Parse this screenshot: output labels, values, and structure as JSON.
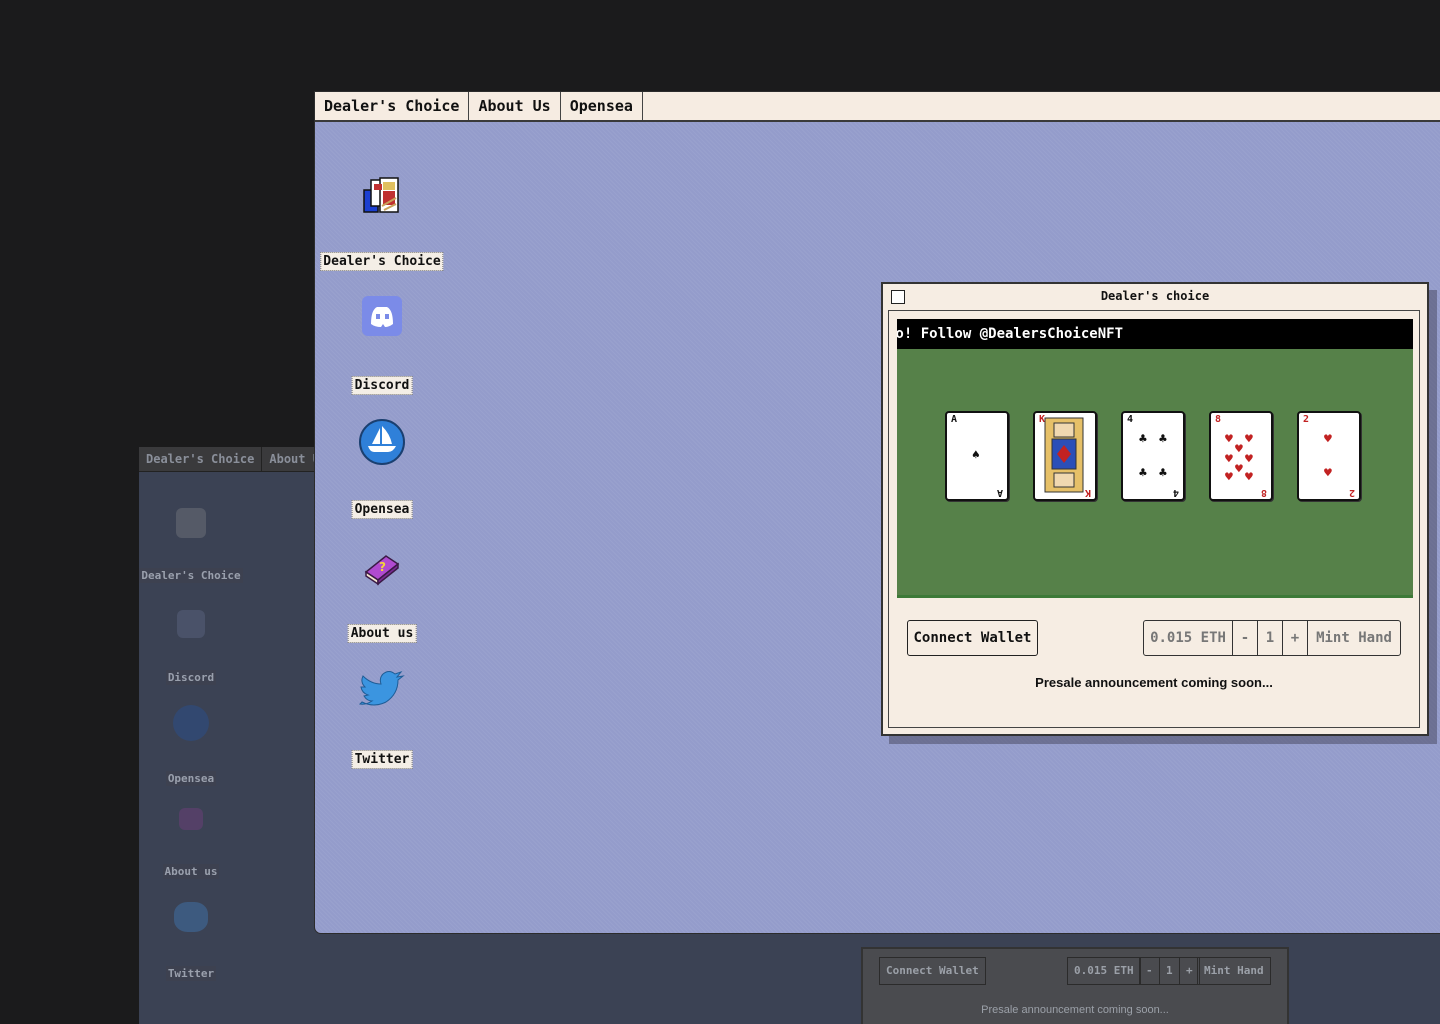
{
  "background_window": {
    "menu": [
      "Dealer's Choice",
      "About U"
    ],
    "icons": [
      "Dealer's Choice",
      "Discord",
      "Opensea",
      "About us",
      "Twitter"
    ],
    "connect_label": "Connect Wallet",
    "price": "0.015 ETH",
    "minus": "-",
    "qty": "1",
    "plus": "+",
    "mint_label": "Mint Hand",
    "presale_note": "Presale announcement coming soon..."
  },
  "menubar": {
    "items": [
      "Dealer's Choice",
      "About Us",
      "Opensea"
    ]
  },
  "desktop_icons": [
    {
      "label": "Dealer's Choice",
      "icon": "cards-king-icon"
    },
    {
      "label": "Discord",
      "icon": "discord-icon"
    },
    {
      "label": "Opensea",
      "icon": "opensea-icon"
    },
    {
      "label": "About us",
      "icon": "book-icon"
    },
    {
      "label": "Twitter",
      "icon": "twitter-icon"
    }
  ],
  "dialog": {
    "title": "Dealer's choice",
    "marquee": "no! Follow @DealersChoiceNFT",
    "cards": [
      {
        "rank": "A",
        "suit": "♠",
        "color": "#111111"
      },
      {
        "rank": "K",
        "suit": "♦",
        "color": "#c22222"
      },
      {
        "rank": "4",
        "suit": "♣",
        "color": "#111111"
      },
      {
        "rank": "8",
        "suit": "♥",
        "color": "#c22222"
      },
      {
        "rank": "2",
        "suit": "♥",
        "color": "#c22222"
      }
    ],
    "connect_label": "Connect Wallet",
    "price": "0.015 ETH",
    "minus": "-",
    "qty": "1",
    "plus": "+",
    "mint_label": "Mint Hand",
    "presale_note": "Presale announcement coming soon..."
  },
  "colors": {
    "desktop": "#949ccb",
    "felt": "#568149",
    "menubar": "#f6ece2"
  }
}
